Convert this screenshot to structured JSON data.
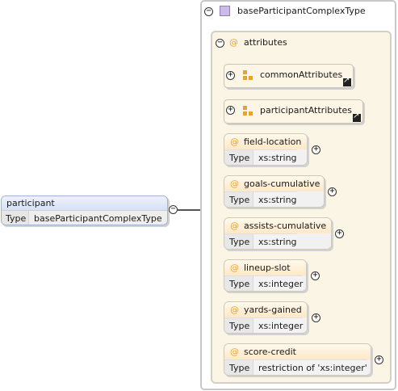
{
  "element": {
    "name": "participant",
    "type_key": "Type",
    "type_value": "baseParticipantComplexType"
  },
  "complex_type": {
    "name": "baseParticipantComplexType"
  },
  "attributes_group": {
    "label": "attributes"
  },
  "attribute_groups": [
    {
      "label": "commonAttributes"
    },
    {
      "label": "participantAttributes"
    }
  ],
  "attributes": [
    {
      "name": "field-location",
      "type_key": "Type",
      "type_value": "xs:string"
    },
    {
      "name": "goals-cumulative",
      "type_key": "Type",
      "type_value": "xs:string"
    },
    {
      "name": "assists-cumulative",
      "type_key": "Type",
      "type_value": "xs:string"
    },
    {
      "name": "lineup-slot",
      "type_key": "Type",
      "type_value": "xs:integer"
    },
    {
      "name": "yards-gained",
      "type_key": "Type",
      "type_value": "xs:integer"
    },
    {
      "name": "score-credit",
      "type_key": "Type",
      "type_value": "restriction of 'xs:integer'"
    }
  ],
  "symbols": {
    "at": "@",
    "expand": "+",
    "collapse": "−"
  },
  "colors": {
    "element_header": "#dbe6f7",
    "attr_header": "#fde8c8",
    "at_symbol": "#e3a53a"
  }
}
